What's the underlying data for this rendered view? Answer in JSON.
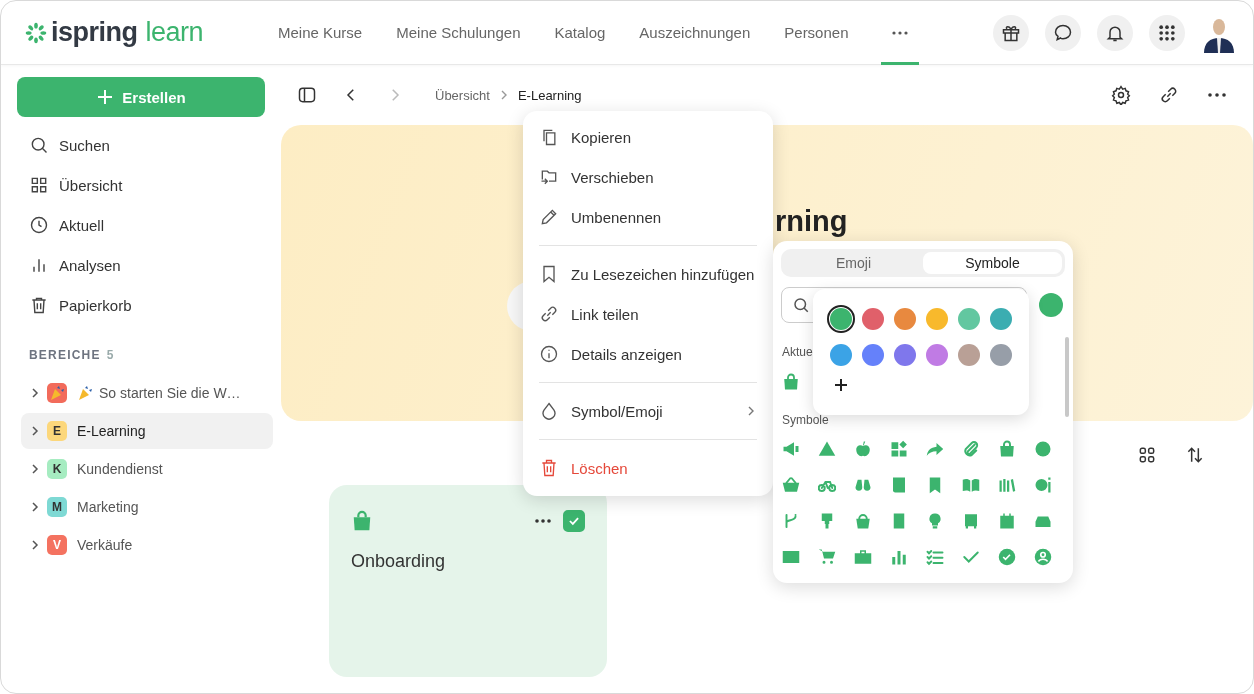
{
  "header": {
    "logo": {
      "word_1": "ispring",
      "word_2": "learn"
    },
    "nav": [
      {
        "kind": "link",
        "label": "Meine Kurse",
        "selected": false
      },
      {
        "kind": "link",
        "label": "Meine Schulungen",
        "selected": false
      },
      {
        "kind": "link",
        "label": "Katalog",
        "selected": false
      },
      {
        "kind": "link",
        "label": "Auszeichnungen",
        "selected": false
      },
      {
        "kind": "link",
        "label": "Personen",
        "selected": false
      },
      {
        "kind": "more",
        "selected": true
      }
    ]
  },
  "sidebar": {
    "create_button": "Erstellen",
    "items": [
      {
        "label": "Suchen"
      },
      {
        "label": "Übersicht"
      },
      {
        "label": "Aktuell"
      },
      {
        "label": "Analysen"
      },
      {
        "label": "Papierkorb"
      }
    ],
    "section": {
      "title": "BEREICHE",
      "count": "5"
    },
    "spaces": [
      {
        "kind": "emoji",
        "color": "#f26b5b",
        "label": "So starten Sie die W…",
        "selected": false
      },
      {
        "kind": "letter",
        "badge": "E",
        "color": "#fcd77b",
        "label": "E-Learning",
        "selected": true
      },
      {
        "kind": "letter",
        "badge": "K",
        "color": "#a6ecc1",
        "label": "Kundendienst",
        "selected": false
      },
      {
        "kind": "letter",
        "badge": "M",
        "color": "#7ed9d4",
        "label": "Marketing",
        "selected": false
      },
      {
        "kind": "letter",
        "badge": "V",
        "color": "#f47260",
        "label": "Verkäufe",
        "selected": false
      }
    ]
  },
  "toolbar": {
    "back": {
      "disabled": false
    },
    "forward": {
      "disabled": true
    },
    "breadcrumb": [
      {
        "label": "Übersicht",
        "current": false
      },
      {
        "label": "E-Learning",
        "current": true
      }
    ]
  },
  "banner": {
    "title": "rning"
  },
  "cards": [
    {
      "title": "Onboarding",
      "checked": true
    }
  ],
  "context_menu": {
    "groups": [
      [
        {
          "label": "Kopieren",
          "submenu": false,
          "danger": false
        },
        {
          "label": "Verschieben",
          "submenu": false,
          "danger": false
        },
        {
          "label": "Umbenennen",
          "submenu": false,
          "danger": false
        }
      ],
      [
        {
          "label": "Zu Lesezeichen hinzufügen",
          "submenu": false,
          "danger": false
        },
        {
          "label": "Link teilen",
          "submenu": false,
          "danger": false
        },
        {
          "label": "Details anzeigen",
          "submenu": false,
          "danger": false
        }
      ],
      [
        {
          "label": "Symbol/Emoji",
          "submenu": true,
          "danger": false
        }
      ],
      [
        {
          "label": "Löschen",
          "submenu": false,
          "danger": true
        }
      ]
    ]
  },
  "symbol_picker": {
    "tabs": [
      {
        "label": "Emoji",
        "selected": false
      },
      {
        "label": "Symbole",
        "selected": true
      }
    ],
    "current_color": {
      "color": "#3cb46e"
    },
    "recent_label": "Aktue",
    "section_label": "Symbole",
    "colors": [
      {
        "color": "#3cb46e",
        "selected": true
      },
      {
        "color": "#e0606a",
        "selected": false
      },
      {
        "color": "#e8893f",
        "selected": false
      },
      {
        "color": "#f8b92c",
        "selected": false
      },
      {
        "color": "#62c7a0",
        "selected": false
      },
      {
        "color": "#3badb1",
        "selected": false
      },
      {
        "color": "#3ba3e6",
        "selected": false
      },
      {
        "color": "#6581fa",
        "selected": false
      },
      {
        "color": "#7f77ec",
        "selected": false
      },
      {
        "color": "#c07be4",
        "selected": false
      },
      {
        "color": "#b9a096",
        "selected": false
      },
      {
        "color": "#979ea8",
        "selected": false
      }
    ]
  }
}
